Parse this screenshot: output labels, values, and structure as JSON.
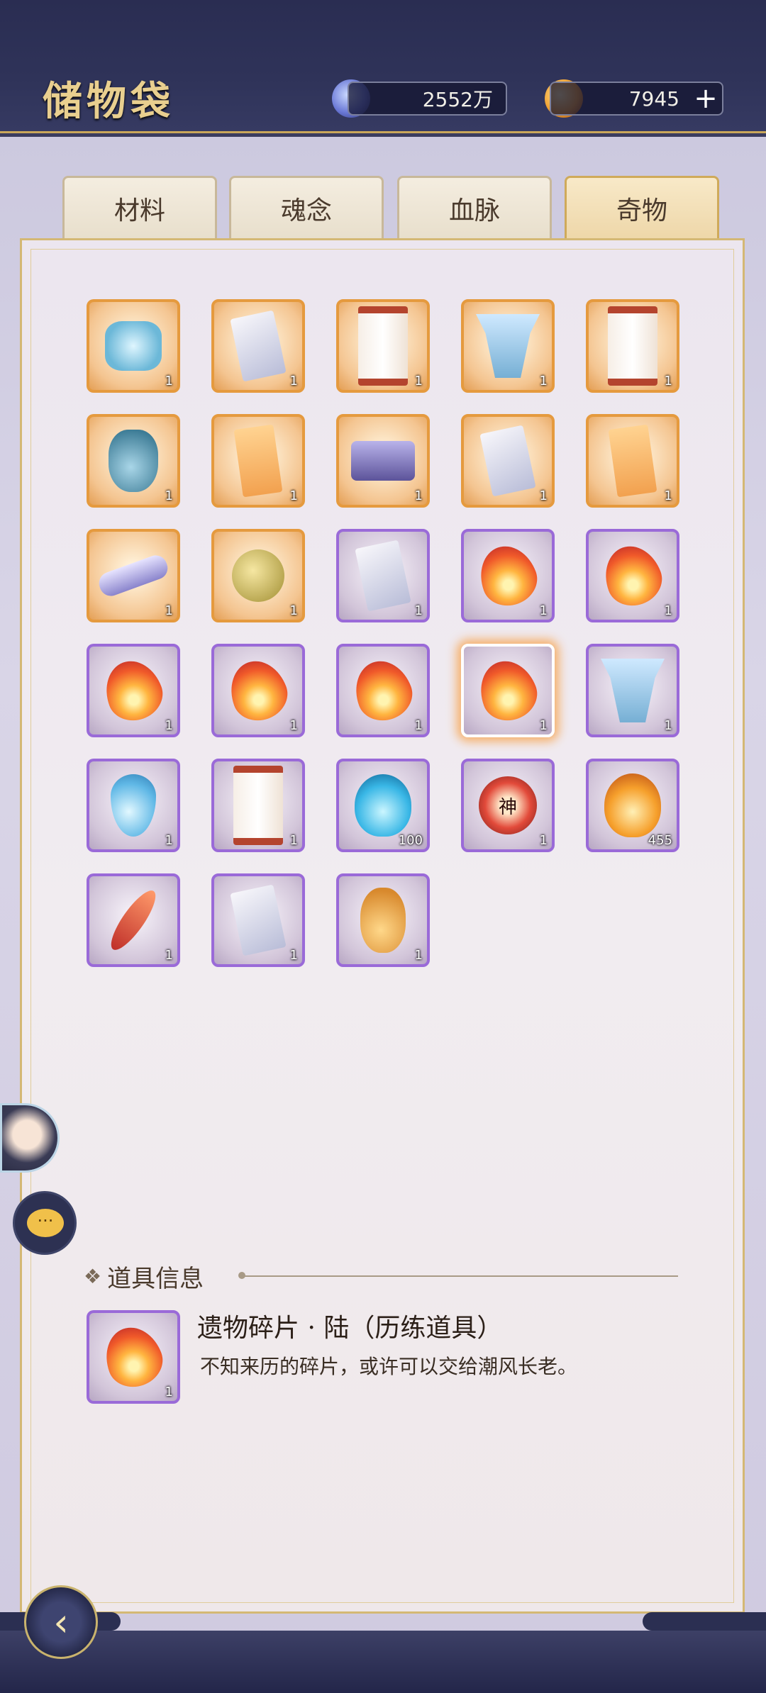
{
  "header": {
    "title": "储物袋",
    "currencies": [
      {
        "icon": "spirit-stone-icon",
        "value": "2552万"
      },
      {
        "icon": "gold-flame-icon",
        "value": "7945"
      }
    ],
    "plus_label": "+"
  },
  "tabs": [
    {
      "label": "材料",
      "active": false
    },
    {
      "label": "魂念",
      "active": false
    },
    {
      "label": "血脉",
      "active": false
    },
    {
      "label": "奇物",
      "active": true
    }
  ],
  "items": [
    {
      "icon": "crystal-shards-icon",
      "rarity": "orange",
      "count": "1"
    },
    {
      "icon": "paper-talisman-icon",
      "rarity": "orange",
      "count": "1"
    },
    {
      "icon": "scroll-icon",
      "rarity": "orange",
      "count": "1"
    },
    {
      "icon": "jade-tie-icon",
      "rarity": "orange",
      "count": "1"
    },
    {
      "icon": "scroll-icon",
      "rarity": "orange",
      "count": "1"
    },
    {
      "icon": "blue-vase-icon",
      "rarity": "orange",
      "count": "1"
    },
    {
      "icon": "orange-talisman-icon",
      "rarity": "orange",
      "count": "1"
    },
    {
      "icon": "treasure-chest-icon",
      "rarity": "orange",
      "count": "1"
    },
    {
      "icon": "paper-sketch-icon",
      "rarity": "orange",
      "count": "1"
    },
    {
      "icon": "painting-icon",
      "rarity": "orange",
      "count": "1"
    },
    {
      "icon": "rolled-scroll-icon",
      "rarity": "orange",
      "count": "1"
    },
    {
      "icon": "golden-bell-icon",
      "rarity": "orange",
      "count": "1"
    },
    {
      "icon": "paper-talisman-icon",
      "rarity": "purple",
      "count": "1"
    },
    {
      "icon": "flame-fragment-icon",
      "rarity": "purple",
      "count": "1"
    },
    {
      "icon": "flame-fragment-icon",
      "rarity": "purple",
      "count": "1"
    },
    {
      "icon": "flame-fragment-icon",
      "rarity": "purple",
      "count": "1"
    },
    {
      "icon": "flame-fragment-icon",
      "rarity": "purple",
      "count": "1"
    },
    {
      "icon": "flame-fragment-icon",
      "rarity": "purple",
      "count": "1"
    },
    {
      "icon": "flame-fragment-icon",
      "rarity": "purple",
      "count": "1",
      "selected": true
    },
    {
      "icon": "jade-tie-icon",
      "rarity": "purple",
      "count": "1"
    },
    {
      "icon": "water-drop-icon",
      "rarity": "purple",
      "count": "1"
    },
    {
      "icon": "scroll-icon",
      "rarity": "purple",
      "count": "1"
    },
    {
      "icon": "blue-flame-icon",
      "rarity": "purple",
      "count": "100"
    },
    {
      "icon": "divine-seal-icon",
      "rarity": "purple",
      "count": "1",
      "glyph": "神"
    },
    {
      "icon": "orange-flame-icon",
      "rarity": "purple",
      "count": "455"
    },
    {
      "icon": "red-feather-icon",
      "rarity": "purple",
      "count": "1"
    },
    {
      "icon": "paper-sketch-icon",
      "rarity": "purple",
      "count": "1"
    },
    {
      "icon": "gourd-icon",
      "rarity": "purple",
      "count": "1"
    }
  ],
  "info": {
    "heading": "道具信息",
    "item_icon": "flame-fragment-icon",
    "item_count": "1",
    "name": "遗物碎片 · 陆（历练道具）",
    "description": "不知来历的碎片，或许可以交给潮风长老。"
  },
  "chat_label": "···",
  "back_label": "‹"
}
